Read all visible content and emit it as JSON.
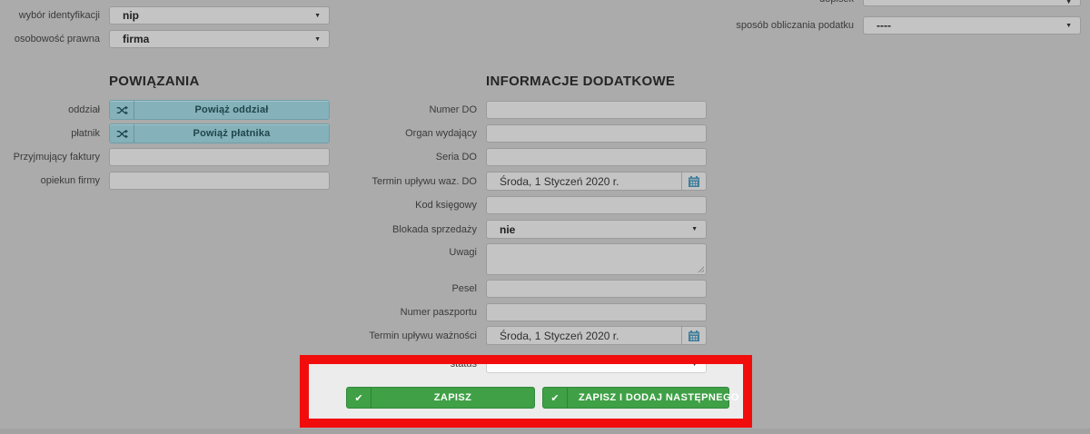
{
  "icons": {
    "caret": "▼",
    "check": "✔"
  },
  "top_left": {
    "rows": [
      {
        "label": "wybór identyfikacji",
        "value": "nip"
      },
      {
        "label": "osobowość prawna",
        "value": "firma"
      }
    ]
  },
  "top_right": {
    "rows": [
      {
        "label": "dopisek",
        "value": ""
      },
      {
        "label": "sposób obliczania podatku",
        "value": "----"
      }
    ]
  },
  "powiazania": {
    "heading": "POWIĄZANIA",
    "rows": [
      {
        "label": "oddział",
        "button": "Powiąż oddział"
      },
      {
        "label": "płatnik",
        "button": "Powiąż płatnika"
      },
      {
        "label": "Przyjmujący faktury",
        "value": ""
      },
      {
        "label": "opiekun firmy",
        "value": ""
      }
    ]
  },
  "informacje": {
    "heading": "INFORMACJE DODATKOWE",
    "rows": [
      {
        "label": "Numer DO",
        "value": ""
      },
      {
        "label": "Organ wydający",
        "value": ""
      },
      {
        "label": "Seria DO",
        "value": ""
      },
      {
        "label": "Termin upływu waz. DO",
        "value": "Środa, 1 Styczeń 2020 r."
      },
      {
        "label": "Kod księgowy",
        "value": ""
      },
      {
        "label": "Blokada sprzedaży",
        "value": "nie"
      },
      {
        "label": "Uwagi",
        "value": ""
      },
      {
        "label": "Pesel",
        "value": ""
      },
      {
        "label": "Numer paszportu",
        "value": ""
      },
      {
        "label": "Termin upływu ważności",
        "value": "Środa, 1 Styczeń 2020 r."
      },
      {
        "label": "status",
        "value": ""
      }
    ]
  },
  "actions": {
    "save": "ZAPISZ",
    "save_and_next": "ZAPISZ I DODAJ NASTĘPNEGO"
  },
  "colors": {
    "highlight_border": "#f20d0d",
    "action_green": "#3fa046",
    "tie_button_teal": "#85b1ba",
    "calendar_icon_blue": "#3f7e9b",
    "page_background": "#ababab"
  }
}
